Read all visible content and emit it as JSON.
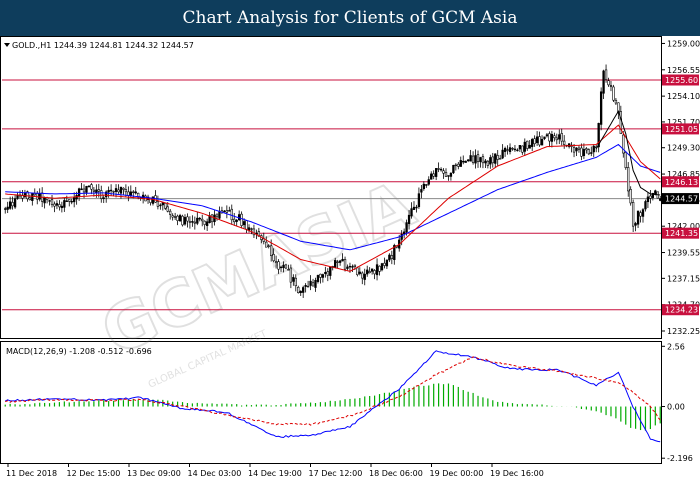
{
  "header": {
    "title": "Chart Analysis for Clients of GCM Asia"
  },
  "main_chart": {
    "info": "GOLD.,H1  1244.39 1244.81 1244.32 1244.57",
    "watermark": "GCMASIA",
    "watermark_sub": "GLOBAL CAPITAL MARKET"
  },
  "chart_data": [
    {
      "type": "candlestick",
      "title": "",
      "symbol": "GOLD.,H1",
      "ohlc_last": {
        "open": 1244.39,
        "high": 1244.81,
        "low": 1244.32,
        "close": 1244.57
      },
      "ylim": [
        1231.6,
        1259.6
      ],
      "y_ticks": [
        1259.0,
        1256.55,
        1254.1,
        1251.7,
        1249.3,
        1246.85,
        1244.45,
        1242.0,
        1239.55,
        1237.15,
        1234.7,
        1232.25
      ],
      "x_tick_labels": [
        "11 Dec 2018",
        "12 Dec 15:00",
        "13 Dec 09:00",
        "14 Dec 03:00",
        "14 Dec 19:00",
        "17 Dec 12:00",
        "18 Dec 06:00",
        "19 Dec 00:00",
        "19 Dec 16:00"
      ],
      "horizontal_levels": [
        1255.6,
        1251.05,
        1246.13,
        1241.35,
        1234.23
      ],
      "current_price": 1244.57,
      "close_path": [
        [
          0,
          1243.5
        ],
        [
          5,
          1244.6
        ],
        [
          10,
          1244.8
        ],
        [
          15,
          1244.6
        ],
        [
          20,
          1243.8
        ],
        [
          25,
          1244.3
        ],
        [
          30,
          1245.2
        ],
        [
          35,
          1245.4
        ],
        [
          40,
          1244.9
        ],
        [
          45,
          1245.6
        ],
        [
          50,
          1245.2
        ],
        [
          55,
          1244.7
        ],
        [
          60,
          1244.4
        ],
        [
          65,
          1243.8
        ],
        [
          70,
          1242.8
        ],
        [
          75,
          1242.1
        ],
        [
          80,
          1242.5
        ],
        [
          85,
          1242.8
        ],
        [
          90,
          1243.1
        ],
        [
          95,
          1242.7
        ],
        [
          100,
          1241.7
        ],
        [
          105,
          1240.4
        ],
        [
          110,
          1238.6
        ],
        [
          115,
          1237.6
        ],
        [
          120,
          1235.8
        ],
        [
          125,
          1236.8
        ],
        [
          130,
          1237.6
        ],
        [
          135,
          1238.6
        ],
        [
          140,
          1238.3
        ],
        [
          145,
          1237.5
        ],
        [
          150,
          1237.9
        ],
        [
          155,
          1238.7
        ],
        [
          160,
          1240.5
        ],
        [
          165,
          1243.2
        ],
        [
          170,
          1245.7
        ],
        [
          175,
          1247.4
        ],
        [
          180,
          1246.9
        ],
        [
          185,
          1247.9
        ],
        [
          190,
          1248.2
        ],
        [
          195,
          1247.9
        ],
        [
          200,
          1248.4
        ],
        [
          205,
          1249.2
        ],
        [
          210,
          1249.3
        ],
        [
          215,
          1249.8
        ],
        [
          220,
          1250.3
        ],
        [
          225,
          1250.2
        ],
        [
          230,
          1249.1
        ],
        [
          235,
          1248.7
        ],
        [
          240,
          1249.6
        ],
        [
          243,
          1256.7
        ],
        [
          246,
          1254.7
        ],
        [
          249,
          1252.5
        ],
        [
          252,
          1247.2
        ],
        [
          255,
          1242.4
        ],
        [
          258,
          1243.3
        ],
        [
          261,
          1244.5
        ],
        [
          264,
          1245.4
        ],
        [
          266,
          1244.57
        ]
      ],
      "moving_averages": [
        {
          "color": "#0000ff",
          "values": [
            [
              0,
              1245.2
            ],
            [
              20,
              1245.0
            ],
            [
              40,
              1245.1
            ],
            [
              60,
              1244.6
            ],
            [
              80,
              1243.9
            ],
            [
              100,
              1242.4
            ],
            [
              120,
              1240.6
            ],
            [
              140,
              1239.8
            ],
            [
              160,
              1241.0
            ],
            [
              180,
              1243.2
            ],
            [
              200,
              1245.4
            ],
            [
              220,
              1247.0
            ],
            [
              240,
              1248.4
            ],
            [
              249,
              1249.6
            ],
            [
              258,
              1247.6
            ],
            [
              266,
              1247.0
            ]
          ]
        },
        {
          "color": "#dd0000",
          "values": [
            [
              0,
              1245.0
            ],
            [
              20,
              1244.6
            ],
            [
              40,
              1244.9
            ],
            [
              60,
              1244.5
            ],
            [
              80,
              1243.2
            ],
            [
              100,
              1241.5
            ],
            [
              120,
              1238.9
            ],
            [
              140,
              1237.8
            ],
            [
              160,
              1240.3
            ],
            [
              180,
              1244.6
            ],
            [
              200,
              1247.6
            ],
            [
              220,
              1249.4
            ],
            [
              240,
              1249.6
            ],
            [
              249,
              1251.4
            ],
            [
              258,
              1248.0
            ],
            [
              266,
              1246.4
            ]
          ]
        },
        {
          "color": "#000000",
          "values": [
            [
              240,
              1249.2
            ],
            [
              249,
              1252.7
            ],
            [
              252,
              1250.6
            ],
            [
              255,
              1247.2
            ],
            [
              258,
              1245.6
            ],
            [
              262,
              1245.0
            ],
            [
              266,
              1244.9
            ]
          ]
        }
      ]
    },
    {
      "type": "bar+line",
      "title": "MACD(12,26,9) -1.208 -0.512 -0.696",
      "indicator": "MACD(12,26,9)",
      "values_shown": [
        -1.208,
        -0.512,
        -0.696
      ],
      "ylim": [
        -2.4,
        2.7
      ],
      "y_ticks": [
        2.56,
        0.0,
        -2.196
      ],
      "histogram": [
        [
          0,
          0.08
        ],
        [
          10,
          0.12
        ],
        [
          20,
          0.18
        ],
        [
          30,
          0.22
        ],
        [
          40,
          0.25
        ],
        [
          50,
          0.3
        ],
        [
          60,
          0.3
        ],
        [
          70,
          0.22
        ],
        [
          80,
          0.12
        ],
        [
          90,
          0.1
        ],
        [
          100,
          0.05
        ],
        [
          110,
          0.08
        ],
        [
          120,
          0.14
        ],
        [
          130,
          0.2
        ],
        [
          140,
          0.32
        ],
        [
          150,
          0.48
        ],
        [
          160,
          0.7
        ],
        [
          170,
          0.9
        ],
        [
          180,
          1.0
        ],
        [
          190,
          0.55
        ],
        [
          200,
          0.22
        ],
        [
          210,
          0.1
        ],
        [
          220,
          0.05
        ],
        [
          230,
          0.0
        ],
        [
          240,
          -0.2
        ],
        [
          249,
          -0.55
        ],
        [
          255,
          -0.95
        ],
        [
          260,
          -1.05
        ],
        [
          266,
          -0.7
        ]
      ],
      "main_line": [
        [
          0,
          0.25
        ],
        [
          20,
          0.32
        ],
        [
          40,
          0.28
        ],
        [
          55,
          0.38
        ],
        [
          70,
          -0.05
        ],
        [
          90,
          -0.25
        ],
        [
          110,
          -1.3
        ],
        [
          125,
          -1.2
        ],
        [
          140,
          -0.85
        ],
        [
          160,
          0.75
        ],
        [
          175,
          2.35
        ],
        [
          190,
          2.1
        ],
        [
          205,
          1.6
        ],
        [
          225,
          1.55
        ],
        [
          240,
          0.9
        ],
        [
          249,
          1.45
        ],
        [
          255,
          0.0
        ],
        [
          262,
          -1.4
        ],
        [
          266,
          -1.5
        ]
      ],
      "signal_line": [
        [
          0,
          0.2
        ],
        [
          20,
          0.3
        ],
        [
          40,
          0.25
        ],
        [
          55,
          0.3
        ],
        [
          70,
          0.05
        ],
        [
          90,
          -0.35
        ],
        [
          110,
          -0.75
        ],
        [
          125,
          -0.75
        ],
        [
          140,
          -0.4
        ],
        [
          160,
          0.4
        ],
        [
          175,
          1.35
        ],
        [
          190,
          2.1
        ],
        [
          205,
          1.75
        ],
        [
          225,
          1.5
        ],
        [
          240,
          1.2
        ],
        [
          249,
          1.0
        ],
        [
          255,
          0.6
        ],
        [
          262,
          0.0
        ],
        [
          266,
          -0.55
        ]
      ]
    }
  ],
  "macd_panel": {
    "label": "MACD(12,26,9) -1.208 -0.512 -0.696"
  },
  "colors": {
    "candle_bull": "#000000",
    "candle_bear": "#ffffff",
    "level_line": "#c8103e",
    "grid": "#000000",
    "macd_hist": "#00aa00",
    "macd_main": "#0000ff",
    "macd_signal": "#dd0000",
    "banner_bg": "#0e3d5c",
    "current_price_bg": "#000000"
  }
}
